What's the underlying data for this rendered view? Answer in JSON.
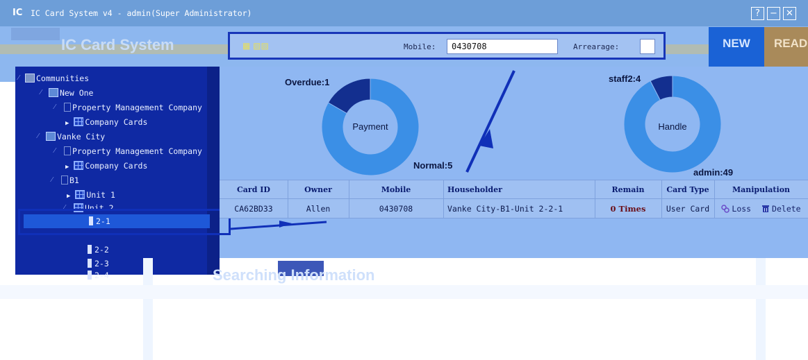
{
  "window": {
    "logo": "IC",
    "title": "IC Card System v4 - admin(Super Administrator)",
    "buttons": {
      "help": "?",
      "minimize": "−",
      "close": "✕"
    }
  },
  "header": {
    "app_title": "IC Card System",
    "new_button": "NEW",
    "read_button": "READ"
  },
  "search": {
    "mobile_label": "Mobile:",
    "mobile_value": "0430708",
    "arrearage_label": "Arrearage:",
    "arrearage_value": ""
  },
  "tree": {
    "items": [
      {
        "label": "Communities",
        "level": 0,
        "icon": "communities-icon"
      },
      {
        "label": "New One",
        "level": 1,
        "icon": "house-icon"
      },
      {
        "label": "Property Management Company",
        "level": 2,
        "icon": "building-icon"
      },
      {
        "label": "Company Cards",
        "level": 3,
        "icon": "grid-icon"
      },
      {
        "label": "Vanke City",
        "level": 1,
        "icon": "house-icon"
      },
      {
        "label": "Property Management Company",
        "level": 2,
        "icon": "building-icon"
      },
      {
        "label": "Company Cards",
        "level": 3,
        "icon": "grid-icon"
      },
      {
        "label": "B1",
        "level": 2,
        "icon": "building-icon"
      },
      {
        "label": "Unit 1",
        "level": 3,
        "icon": "grid-icon"
      },
      {
        "label": "Unit 2",
        "level": 3,
        "icon": "grid-icon"
      },
      {
        "label": "2-1",
        "level": 4,
        "icon": "room-icon",
        "selected": true
      },
      {
        "label": "2-2",
        "level": 4,
        "icon": "room-icon"
      },
      {
        "label": "2-3",
        "level": 4,
        "icon": "room-icon"
      },
      {
        "label": "2-4",
        "level": 4,
        "icon": "room-icon"
      }
    ]
  },
  "chart_data": [
    {
      "type": "pie",
      "title": "Payment",
      "categories": [
        "Overdue",
        "Normal"
      ],
      "values": [
        1,
        5
      ],
      "labels": [
        "Overdue:1",
        "Normal:5"
      ],
      "colors": [
        "#132f8f",
        "#3b8fe6"
      ]
    },
    {
      "type": "pie",
      "title": "Handle",
      "categories": [
        "staff2",
        "admin"
      ],
      "values": [
        4,
        49
      ],
      "labels": [
        "staff2:4",
        "admin:49"
      ],
      "colors": [
        "#132f8f",
        "#3b8fe6"
      ]
    }
  ],
  "table": {
    "headers": [
      "Card ID",
      "Owner",
      "Mobile",
      "Householder",
      "Remain",
      "Card Type",
      "Manipulation"
    ],
    "rows": [
      {
        "card_id": "CA62BD33",
        "owner": "Allen",
        "mobile": "0430708",
        "householder": "Vanke City-B1-Unit 2-2-1",
        "remain": "0 Times",
        "card_type": "User Card",
        "loss": "Loss",
        "delete": "Delete"
      }
    ]
  },
  "watermark": "Searching Information",
  "colors": {
    "titlebar": "#6d9ed8",
    "tree_bg": "#0f29a3",
    "main_bg": "#8fb7f2",
    "new_button": "#1a62d6",
    "read_button": "#a98a5a",
    "annotation": "#1030b8"
  }
}
